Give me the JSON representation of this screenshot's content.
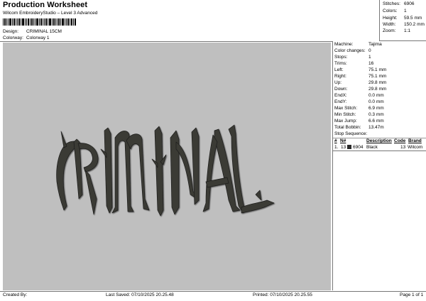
{
  "header": {
    "title": "Production Worksheet",
    "subtitle": "Wilcom EmbroideryStudio – Level 3 Advanced",
    "design_label": "Design:",
    "design_value": "CRIMINAL 15CM",
    "colorway_label": "Colorway:",
    "colorway_value": "Colorway 1"
  },
  "stats": [
    {
      "label": "Stitches:",
      "value": "6906"
    },
    {
      "label": "Colors:",
      "value": "1"
    },
    {
      "label": "Height:",
      "value": "59.5 mm"
    },
    {
      "label": "Width:",
      "value": "150.2 mm"
    },
    {
      "label": "Zoom:",
      "value": "1:1"
    }
  ],
  "preview": {
    "background": "#bfbfbf",
    "thread_color": "#3a3a36",
    "design_text": "CRIMINAL"
  },
  "info": [
    {
      "label": "Machine:",
      "value": "Tajima"
    },
    {
      "label": "Color changes:",
      "value": "0"
    },
    {
      "label": "Stops:",
      "value": "1"
    },
    {
      "label": "Trims:",
      "value": "16"
    },
    {
      "label": "Left:",
      "value": "75.1 mm"
    },
    {
      "label": "Right:",
      "value": "75.1 mm"
    },
    {
      "label": "Up:",
      "value": "29.8 mm"
    },
    {
      "label": "Down:",
      "value": "29.8 mm"
    },
    {
      "label": "EndX:",
      "value": "0.0 mm"
    },
    {
      "label": "EndY:",
      "value": "0.0 mm"
    },
    {
      "label": "Max Stitch:",
      "value": "6.9 mm"
    },
    {
      "label": "Min Stitch:",
      "value": "0.3 mm"
    },
    {
      "label": "Max Jump:",
      "value": "6.6 mm"
    },
    {
      "label": "Total Bobbin:",
      "value": "13.47m"
    }
  ],
  "stop_sequence": {
    "title": "Stop Sequence:",
    "headers": [
      "#",
      "N#",
      "Description",
      "Code",
      "Brand"
    ],
    "rows": [
      {
        "num": "1.",
        "n": "13",
        "stitches": "6904",
        "description": "Black",
        "code": "13",
        "brand": "Wilcom",
        "swatch": "#2a2a2a"
      }
    ]
  },
  "footer": {
    "created": "Created By:",
    "saved": "Last Saved: 07/10/2025 20.25.48",
    "printed": "Printed: 07/10/2025 20.25.55",
    "page": "Page 1 of 1"
  }
}
